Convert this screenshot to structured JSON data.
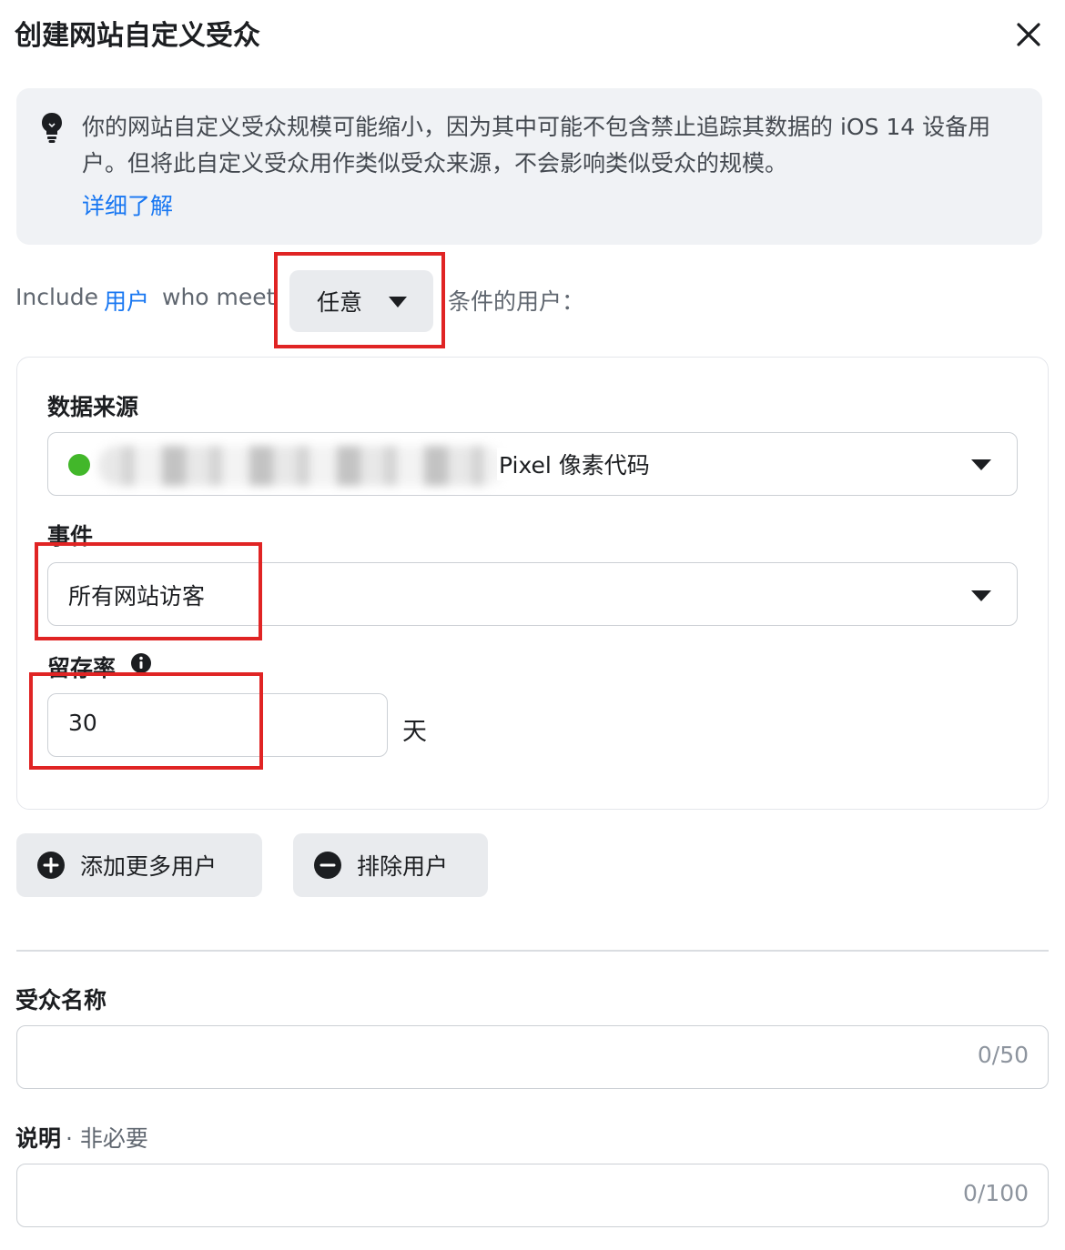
{
  "header": {
    "title": "创建网站自定义受众"
  },
  "notice": {
    "text": "你的网站自定义受众规模可能缩小，因为其中可能不包含禁止追踪其数据的 iOS 14 设备用户。但将此自定义受众用作类似受众来源，不会影响类似受众的规模。",
    "link": "详细了解"
  },
  "include_row": {
    "prefix": "Include",
    "link": "用户",
    "middle": "who meet",
    "selector_value": "任意",
    "suffix": "条件的用户："
  },
  "rule": {
    "source_label": "数据来源",
    "source_value_visible": "Pixel 像素代码",
    "event_label": "事件",
    "event_value": "所有网站访客",
    "retention_label": "留存率",
    "retention_value": "30",
    "retention_unit": "天"
  },
  "actions": {
    "add_more": "添加更多用户",
    "exclude": "排除用户"
  },
  "audience_name": {
    "label": "受众名称",
    "counter": "0/50"
  },
  "description": {
    "label": "说明",
    "optional": " · 非必要",
    "counter": "0/100"
  },
  "colors": {
    "link": "#1877f2",
    "status_dot": "#42b72a",
    "highlight": "#e02424"
  }
}
